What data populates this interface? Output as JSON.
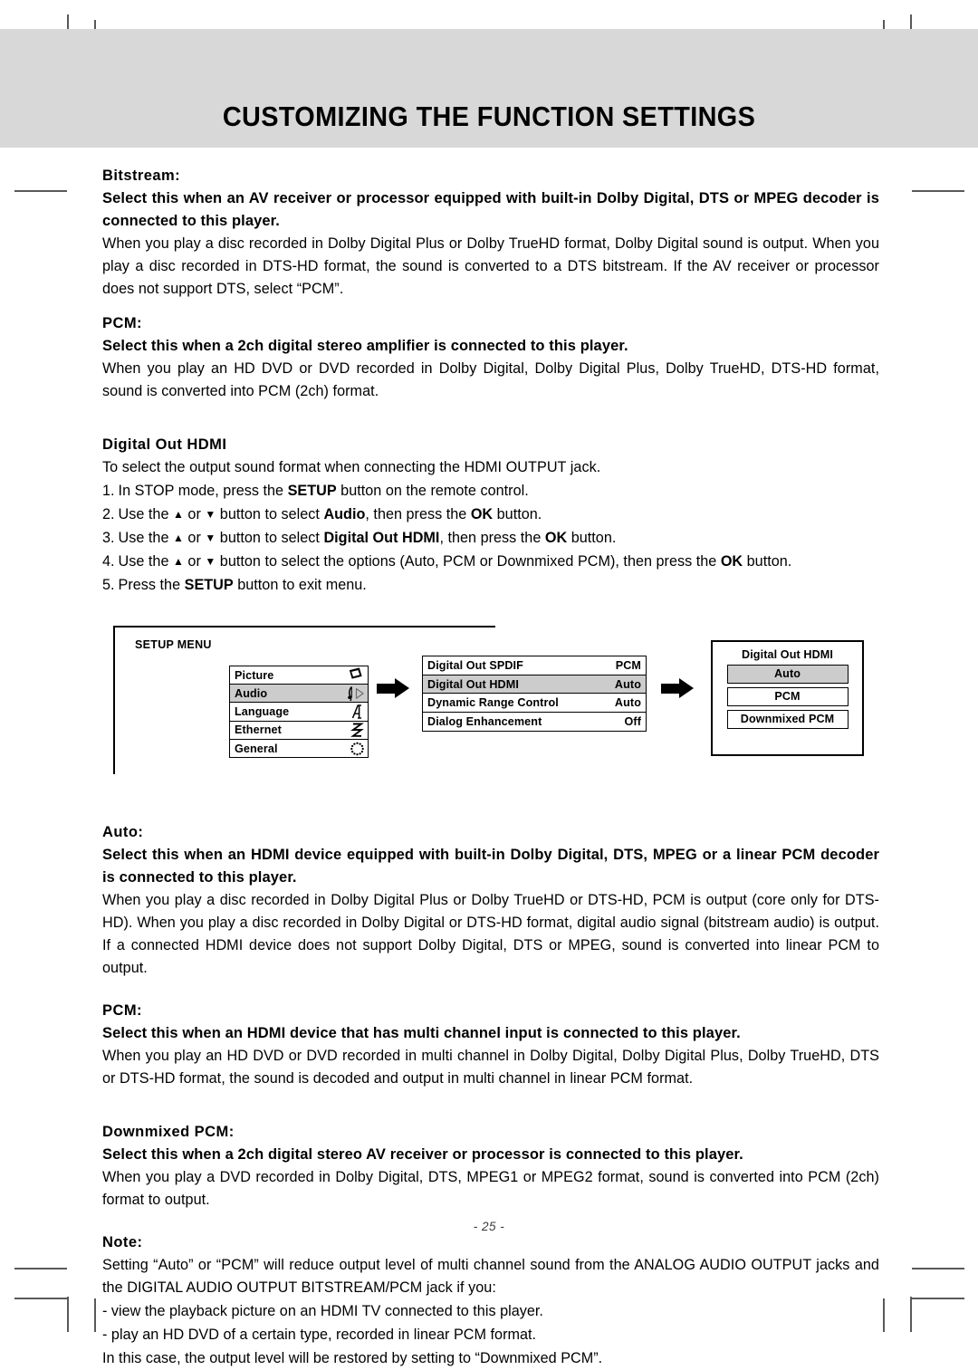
{
  "page": {
    "title": "CUSTOMIZING THE FUNCTION SETTINGS",
    "page_number": "- 25 -",
    "header_band_color": "#d8d8d8",
    "highlight_color": "#cccccc"
  },
  "sections": {
    "bitstream": {
      "heading": "Bitstream:",
      "lead": "Select this when an AV receiver or processor equipped with built-in Dolby Digital, DTS or MPEG decoder is connected to this player.",
      "body": "When you play a disc recorded in Dolby Digital Plus or Dolby TrueHD format, Dolby Digital sound is output. When you play a disc recorded in DTS-HD format, the sound is converted to a DTS bitstream. If the AV receiver or processor does not support DTS, select “PCM”."
    },
    "pcm_spdif": {
      "heading": "PCM:",
      "lead": "Select this when a 2ch digital stereo amplifier is connected to this player.",
      "body": "When you play an HD DVD or DVD recorded in Dolby Digital, Dolby Digital Plus, Dolby TrueHD, DTS-HD format, sound is converted into PCM (2ch) format."
    },
    "digital_out_hdmi": {
      "heading": "Digital Out HDMI",
      "body": "To select the output sound format when connecting the HDMI OUTPUT jack.",
      "steps": [
        {
          "num": "1.",
          "parts": [
            {
              "t": "In STOP mode, press the ",
              "b": false
            },
            {
              "t": "SETUP",
              "b": true
            },
            {
              "t": " button on the remote control.",
              "b": false
            }
          ]
        },
        {
          "num": "2.",
          "parts": [
            {
              "t": "Use the ",
              "b": false
            },
            {
              "t": "▲",
              "b": false,
              "tri": true
            },
            {
              "t": " or ",
              "b": false
            },
            {
              "t": "▼",
              "b": false,
              "tri": true
            },
            {
              "t": " button to select ",
              "b": false
            },
            {
              "t": "Audio",
              "b": true
            },
            {
              "t": ", then press the ",
              "b": false
            },
            {
              "t": "OK",
              "b": true
            },
            {
              "t": " button.",
              "b": false
            }
          ]
        },
        {
          "num": "3.",
          "parts": [
            {
              "t": "Use the ",
              "b": false
            },
            {
              "t": "▲",
              "b": false,
              "tri": true
            },
            {
              "t": " or ",
              "b": false
            },
            {
              "t": "▼",
              "b": false,
              "tri": true
            },
            {
              "t": " button to select ",
              "b": false
            },
            {
              "t": "Digital Out HDMI",
              "b": true
            },
            {
              "t": ", then press the ",
              "b": false
            },
            {
              "t": "OK",
              "b": true
            },
            {
              "t": " button.",
              "b": false
            }
          ]
        },
        {
          "num": "4.",
          "parts": [
            {
              "t": "Use the ",
              "b": false
            },
            {
              "t": "▲",
              "b": false,
              "tri": true
            },
            {
              "t": " or ",
              "b": false
            },
            {
              "t": "▼",
              "b": false,
              "tri": true
            },
            {
              "t": " button to select the options (Auto, PCM or Downmixed PCM), then press the ",
              "b": false
            },
            {
              "t": "OK",
              "b": true
            },
            {
              "t": " button.",
              "b": false
            }
          ]
        },
        {
          "num": "5.",
          "parts": [
            {
              "t": "Press the ",
              "b": false
            },
            {
              "t": "SETUP",
              "b": true
            },
            {
              "t": " button to exit menu.",
              "b": false
            }
          ]
        }
      ]
    },
    "auto": {
      "heading": "Auto:",
      "lead": "Select this when an HDMI device equipped with built-in Dolby Digital, DTS, MPEG or a linear PCM decoder is connected to this player.",
      "body": "When you play a disc recorded in Dolby Digital Plus or Dolby TrueHD or DTS-HD, PCM is output (core only for DTS-HD). When you play a disc recorded in Dolby Digital or DTS-HD format, digital audio signal (bitstream audio) is output. If a connected HDMI device does not support Dolby Digital, DTS or MPEG, sound is converted into linear PCM to output."
    },
    "pcm_hdmi": {
      "heading": "PCM:",
      "lead": "Select this when an HDMI device that has multi channel input is connected to this player.",
      "body": "When you play an HD DVD or DVD recorded in multi channel in Dolby Digital, Dolby Digital Plus, Dolby TrueHD, DTS or DTS-HD format, the sound is decoded and output in multi channel in linear PCM format."
    },
    "downmixed_pcm": {
      "heading": "Downmixed PCM:",
      "lead": "Select this when a 2ch digital stereo AV receiver or processor is connected to this player.",
      "body": "When you play a DVD recorded in Dolby Digital, DTS, MPEG1 or MPEG2 format, sound is converted into PCM (2ch) format to output."
    },
    "note": {
      "heading": "Note:",
      "body": "Setting “Auto” or “PCM” will reduce output level of multi channel sound from the ANALOG AUDIO OUTPUT jacks and the DIGITAL AUDIO OUTPUT BITSTREAM/PCM jack if you:",
      "bullets": [
        "- view the playback picture on an HDMI TV connected to this player.",
        "- play an HD DVD of a certain type, recorded in linear PCM format."
      ],
      "closing": "In this case, the output level will be restored by setting to “Downmixed PCM”."
    }
  },
  "diagram": {
    "setup_menu_label": "SETUP MENU",
    "setup_items": [
      {
        "label": "Picture",
        "icon": "diamond-icon",
        "selected": false
      },
      {
        "label": "Audio",
        "icon": "music-note-icon",
        "selected": true
      },
      {
        "label": "Language",
        "icon": "letter-a-icon",
        "selected": false
      },
      {
        "label": "Ethernet",
        "icon": "network-zigzag-icon",
        "selected": false
      },
      {
        "label": "General",
        "icon": "dotted-circle-icon",
        "selected": false
      }
    ],
    "audio_items": [
      {
        "label": "Digital Out SPDIF",
        "value": "PCM",
        "selected": false
      },
      {
        "label": "Digital Out HDMI",
        "value": "Auto",
        "selected": true
      },
      {
        "label": "Dynamic Range Control",
        "value": "Auto",
        "selected": false
      },
      {
        "label": "Dialog Enhancement",
        "value": "Off",
        "selected": false
      }
    ],
    "hdmi_box": {
      "title": "Digital Out HDMI",
      "options": [
        {
          "label": "Auto",
          "selected": true
        },
        {
          "label": "PCM",
          "selected": false
        },
        {
          "label": "Downmixed PCM",
          "selected": false
        }
      ]
    }
  }
}
